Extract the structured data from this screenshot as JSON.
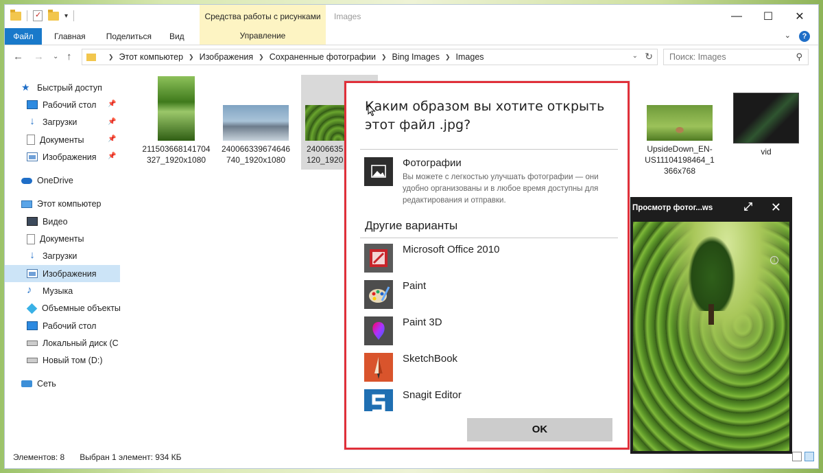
{
  "titlebar": {
    "contextual_group": "Средства работы с рисунками",
    "window_title": "Images",
    "minimize_glyph": "—",
    "maximize_glyph": "☐",
    "close_glyph": "✕"
  },
  "ribbon": {
    "tabs": [
      "Файл",
      "Главная",
      "Поделиться",
      "Вид"
    ],
    "contextual_tab": "Управление"
  },
  "address": {
    "crumbs": [
      "Этот компьютер",
      "Изображения",
      "Сохраненные фотографии",
      "Bing Images",
      "Images"
    ],
    "search_placeholder": "Поиск: Images"
  },
  "sidebar": {
    "items": [
      {
        "label": "Быстрый доступ",
        "icon": "star-icon"
      },
      {
        "label": "Рабочий стол",
        "icon": "desktop-icon"
      },
      {
        "label": "Загрузки",
        "icon": "downloads-icon"
      },
      {
        "label": "Документы",
        "icon": "documents-icon"
      },
      {
        "label": "Изображения",
        "icon": "pictures-icon"
      },
      {
        "label": "OneDrive",
        "icon": "onedrive-icon"
      },
      {
        "label": "Этот компьютер",
        "icon": "this-pc-icon"
      },
      {
        "label": "Видео",
        "icon": "video-icon"
      },
      {
        "label": "Документы",
        "icon": "documents-icon"
      },
      {
        "label": "Загрузки",
        "icon": "downloads-icon"
      },
      {
        "label": "Изображения",
        "icon": "pictures-icon"
      },
      {
        "label": "Музыка",
        "icon": "music-icon"
      },
      {
        "label": "Объемные объекты",
        "icon": "3d-objects-icon"
      },
      {
        "label": "Рабочий стол",
        "icon": "desktop-icon"
      },
      {
        "label": "Локальный диск (C",
        "icon": "drive-icon"
      },
      {
        "label": "Новый том (D:)",
        "icon": "drive-icon"
      },
      {
        "label": "Сеть",
        "icon": "network-icon"
      }
    ]
  },
  "files": [
    {
      "name": "211503668141704\n327_1920x1080"
    },
    {
      "name": "240066339674646\n740_1920x1080"
    },
    {
      "name": "24006635\n120_1920"
    },
    {
      "name": "UpsideDown_EN-\nUS11104198464_1\n366x768"
    },
    {
      "name": "vid"
    }
  ],
  "viewer": {
    "title": "Просмотр фотог...ws",
    "info_glyph": "i"
  },
  "dialog": {
    "question": "Каким образом вы хотите открыть этот файл .jpg?",
    "recommended": {
      "name": "Фотографии",
      "description": "Вы можете с легкостью улучшать фотографии — они удобно организованы и в любое время доступны для редактирования и отправки."
    },
    "other_heading": "Другие варианты",
    "apps": [
      "Microsoft Office 2010",
      "Paint",
      "Paint 3D",
      "SketchBook",
      "Snagit Editor"
    ],
    "ok_label": "OK"
  },
  "status": {
    "count": "Элементов: 8",
    "selected": "Выбран 1 элемент: 934 КБ"
  },
  "colors": {
    "accent": "#1979ca",
    "dialog_border": "#e0303a",
    "contextual": "#fdf4c3"
  }
}
